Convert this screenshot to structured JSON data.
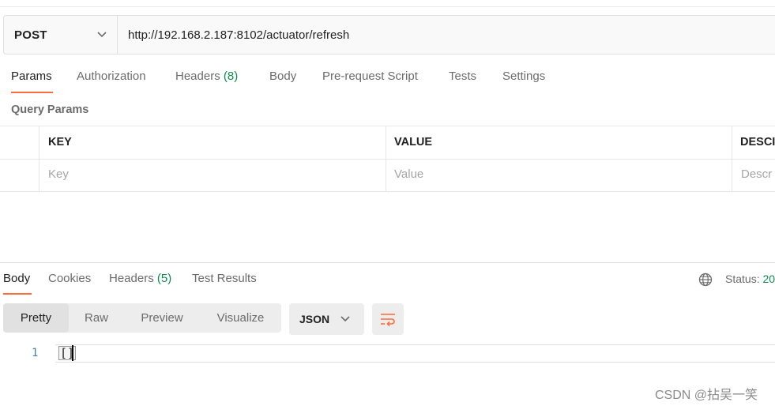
{
  "request": {
    "method": "POST",
    "url": "http://192.168.2.187:8102/actuator/refresh"
  },
  "request_tabs": [
    {
      "label": "Params",
      "active": true
    },
    {
      "label": "Authorization"
    },
    {
      "label": "Headers",
      "count": "(8)"
    },
    {
      "label": "Body"
    },
    {
      "label": "Pre-request Script"
    },
    {
      "label": "Tests"
    },
    {
      "label": "Settings"
    }
  ],
  "query_params": {
    "title": "Query Params",
    "columns": [
      "KEY",
      "VALUE",
      "DESCI"
    ],
    "placeholders": [
      "Key",
      "Value",
      "Descr"
    ]
  },
  "response_tabs": [
    {
      "label": "Body",
      "active": true
    },
    {
      "label": "Cookies"
    },
    {
      "label": "Headers",
      "count": "(5)"
    },
    {
      "label": "Test Results"
    }
  ],
  "status": {
    "label": "Status:",
    "value": "20"
  },
  "view_modes": [
    {
      "label": "Pretty",
      "active": true
    },
    {
      "label": "Raw"
    },
    {
      "label": "Preview"
    },
    {
      "label": "Visualize"
    }
  ],
  "format": "JSON",
  "code": {
    "line_number": "1",
    "text": "[]"
  },
  "watermark": "CSDN @拈吴一笑",
  "colors": {
    "accent": "#ff6c37",
    "count_green": "#0f8a4f"
  },
  "icons": [
    "chevron-down-icon",
    "globe-icon",
    "wrap-lines-icon"
  ]
}
